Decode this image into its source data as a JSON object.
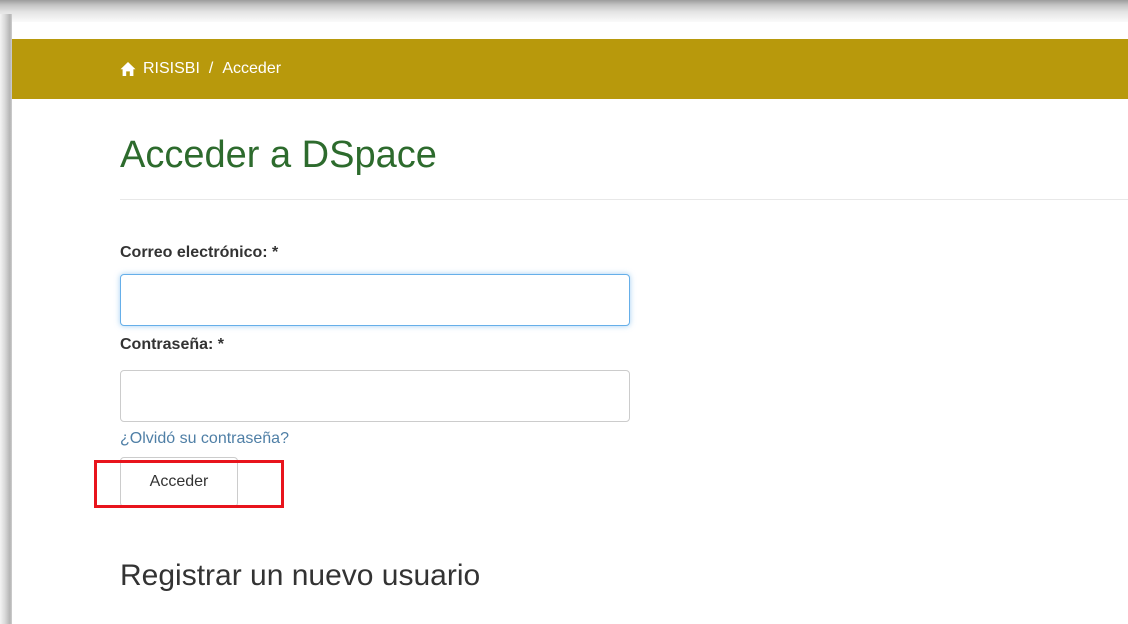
{
  "breadcrumb": {
    "home_icon": "home-icon",
    "home": "RISISBI",
    "separator": "/",
    "current": "Acceder"
  },
  "page": {
    "title": "Acceder a DSpace"
  },
  "form": {
    "email_label": "Correo electrónico: *",
    "email_value": "",
    "password_label": "Contraseña: *",
    "password_value": "",
    "forgot_password": "¿Olvidó su contraseña?",
    "submit_label": "Acceder"
  },
  "register": {
    "heading": "Registrar un nuevo usuario"
  },
  "colors": {
    "header_bar": "#b8990c",
    "title": "#2d6b2d",
    "link": "#4f7fa6",
    "highlight": "#e8141c"
  }
}
